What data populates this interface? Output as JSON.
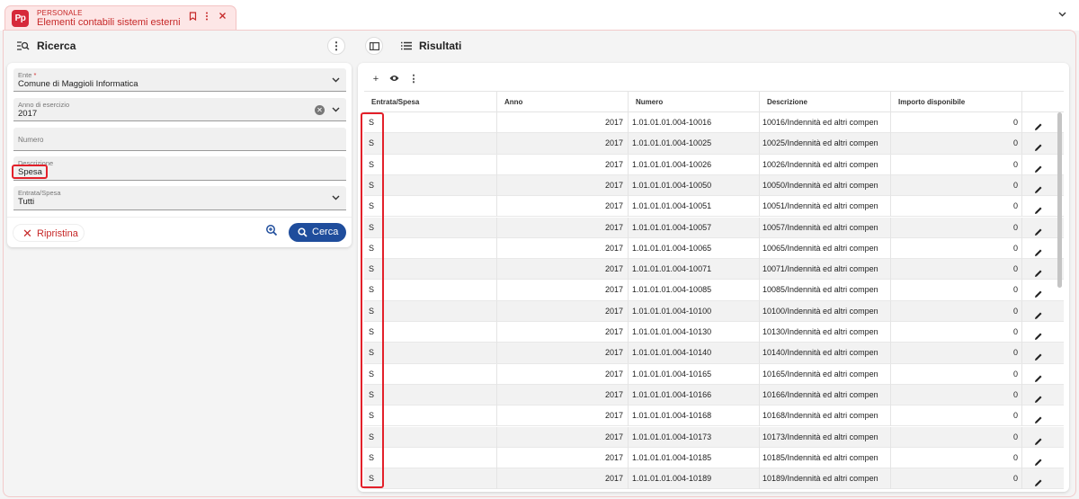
{
  "app": {
    "module": "PERSONALE",
    "title": "Elementi contabili sistemi esterni",
    "logo_text": "Pp",
    "brand_color": "#d6293a"
  },
  "search_panel": {
    "title": "Ricerca",
    "fields": {
      "ente": {
        "label": "Ente",
        "required_mark": "*",
        "value": "Comune di Maggioli Informatica"
      },
      "anno": {
        "label": "Anno di esercizio",
        "value": "2017"
      },
      "numero": {
        "label": "Numero",
        "value": ""
      },
      "descrizione": {
        "label": "Descrizione",
        "value": "Spesa"
      },
      "entrata_spesa": {
        "label": "Entrata/Spesa",
        "value": "Tutti"
      }
    },
    "reset_label": "Ripristina",
    "search_label": "Cerca",
    "primary_color": "#1f4d9c"
  },
  "results": {
    "title": "Risultati",
    "columns": [
      "Entrata/Spesa",
      "Anno",
      "Numero",
      "Descrizione",
      "Importo disponibile"
    ],
    "rows": [
      [
        "S",
        "2017",
        "1.01.01.01.004-10016",
        "10016/Indennità ed altri compen",
        "0"
      ],
      [
        "S",
        "2017",
        "1.01.01.01.004-10025",
        "10025/Indennità ed altri compen",
        "0"
      ],
      [
        "S",
        "2017",
        "1.01.01.01.004-10026",
        "10026/Indennità ed altri compen",
        "0"
      ],
      [
        "S",
        "2017",
        "1.01.01.01.004-10050",
        "10050/Indennità ed altri compen",
        "0"
      ],
      [
        "S",
        "2017",
        "1.01.01.01.004-10051",
        "10051/Indennità ed altri compen",
        "0"
      ],
      [
        "S",
        "2017",
        "1.01.01.01.004-10057",
        "10057/Indennità ed altri compen",
        "0"
      ],
      [
        "S",
        "2017",
        "1.01.01.01.004-10065",
        "10065/Indennità ed altri compen",
        "0"
      ],
      [
        "S",
        "2017",
        "1.01.01.01.004-10071",
        "10071/Indennità ed altri compen",
        "0"
      ],
      [
        "S",
        "2017",
        "1.01.01.01.004-10085",
        "10085/Indennità ed altri compen",
        "0"
      ],
      [
        "S",
        "2017",
        "1.01.01.01.004-10100",
        "10100/Indennità ed altri compen",
        "0"
      ],
      [
        "S",
        "2017",
        "1.01.01.01.004-10130",
        "10130/Indennità ed altri compen",
        "0"
      ],
      [
        "S",
        "2017",
        "1.01.01.01.004-10140",
        "10140/Indennità ed altri compen",
        "0"
      ],
      [
        "S",
        "2017",
        "1.01.01.01.004-10165",
        "10165/Indennità ed altri compen",
        "0"
      ],
      [
        "S",
        "2017",
        "1.01.01.01.004-10166",
        "10166/Indennità ed altri compen",
        "0"
      ],
      [
        "S",
        "2017",
        "1.01.01.01.004-10168",
        "10168/Indennità ed altri compen",
        "0"
      ],
      [
        "S",
        "2017",
        "1.01.01.01.004-10173",
        "10173/Indennità ed altri compen",
        "0"
      ],
      [
        "S",
        "2017",
        "1.01.01.01.004-10185",
        "10185/Indennità ed altri compen",
        "0"
      ],
      [
        "S",
        "2017",
        "1.01.01.01.004-10189",
        "10189/Indennità ed altri compen",
        "0"
      ]
    ]
  },
  "icons": [
    "bookmark-icon",
    "more-vert-icon",
    "close-icon",
    "chevron-down-icon",
    "search-list-icon",
    "panel-toggle-icon",
    "list-icon",
    "add-icon",
    "eye-icon",
    "zoom-in-icon",
    "search-icon",
    "edit-icon"
  ],
  "highlight_color": "#e3202a"
}
